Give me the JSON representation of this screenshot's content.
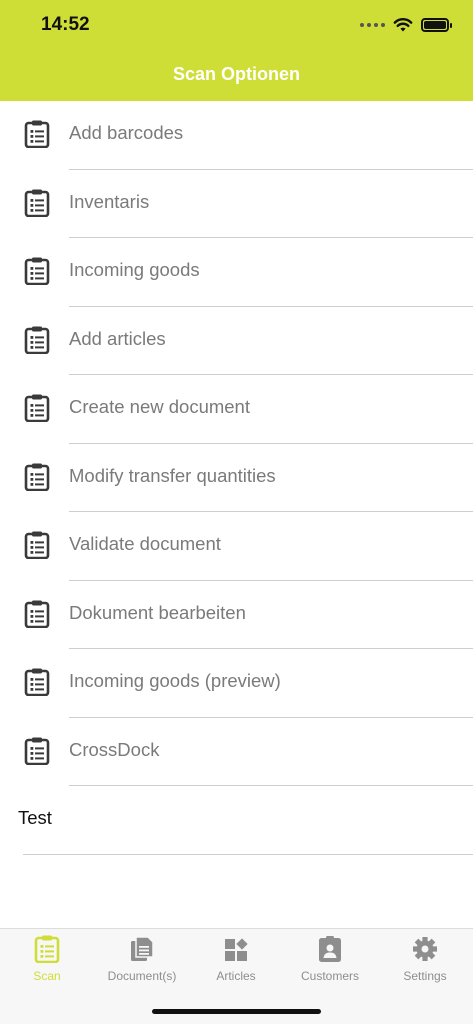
{
  "status_bar": {
    "time": "14:52"
  },
  "header": {
    "title": "Scan Optionen"
  },
  "menu": {
    "items": [
      {
        "label": "Add barcodes"
      },
      {
        "label": "Inventaris"
      },
      {
        "label": "Incoming goods"
      },
      {
        "label": "Add articles"
      },
      {
        "label": "Create new document"
      },
      {
        "label": "Modify transfer quantities"
      },
      {
        "label": "Validate document"
      },
      {
        "label": "Dokument bearbeiten"
      },
      {
        "label": "Incoming goods (preview)"
      },
      {
        "label": "CrossDock"
      }
    ],
    "item_icon": "clipboard-list-icon"
  },
  "extra": {
    "label": "Test"
  },
  "tabs": [
    {
      "label": "Scan",
      "icon": "clipboard-list-icon",
      "active": true
    },
    {
      "label": "Document(s)",
      "icon": "documents-icon",
      "active": false
    },
    {
      "label": "Articles",
      "icon": "articles-icon",
      "active": false
    },
    {
      "label": "Customers",
      "icon": "customer-card-icon",
      "active": false
    },
    {
      "label": "Settings",
      "icon": "gear-icon",
      "active": false
    }
  ],
  "colors": {
    "accent": "#cfdd37",
    "header_text": "#ffffff",
    "item_text": "#7a7a7a",
    "icon": "#3a3a3a",
    "tab_inactive": "#8e8e8e"
  }
}
